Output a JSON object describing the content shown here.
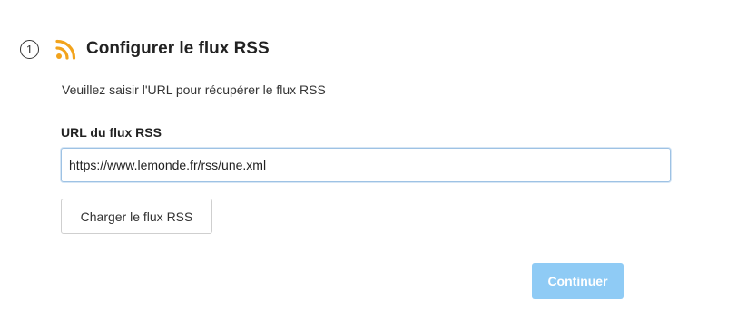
{
  "step": {
    "number": "1",
    "icon": "rss-icon",
    "title": "Configurer le flux RSS",
    "description": "Veuillez saisir l'URL pour récupérer le flux RSS"
  },
  "form": {
    "url_label": "URL du flux RSS",
    "url_value": "https://www.lemonde.fr/rss/une.xml",
    "load_button": "Charger le flux RSS"
  },
  "footer": {
    "continue_button": "Continuer"
  },
  "colors": {
    "accent": "#f2a31c",
    "continue_bg": "#8fcbf5",
    "input_border": "#9ec2e4"
  }
}
